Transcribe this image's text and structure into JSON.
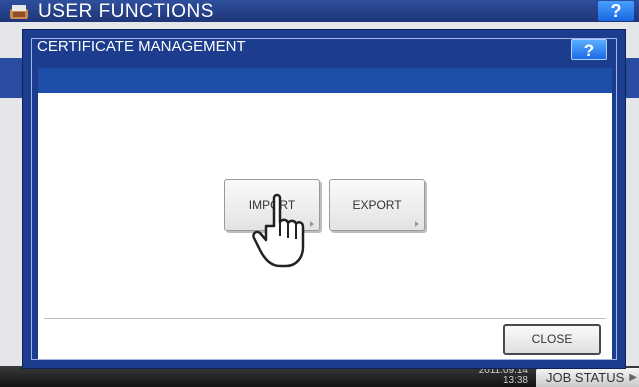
{
  "background": {
    "title": "USER FUNCTIONS",
    "help_label": "?",
    "datetime_date": "2011.09.14",
    "datetime_time": "13:38",
    "job_status_label": "JOB STATUS"
  },
  "dialog": {
    "title": "CERTIFICATE MANAGEMENT",
    "help_label": "?",
    "buttons": {
      "import_label": "IMPORT",
      "export_label": "EXPORT",
      "close_label": "CLOSE"
    }
  },
  "colors": {
    "title_bar": "#1d3577",
    "dialog_frame": "#1c3c8e",
    "help_button": "#1a6ae6"
  },
  "icons": [
    "user-functions-icon",
    "pointing-hand-icon",
    "arrow-right-icon"
  ]
}
